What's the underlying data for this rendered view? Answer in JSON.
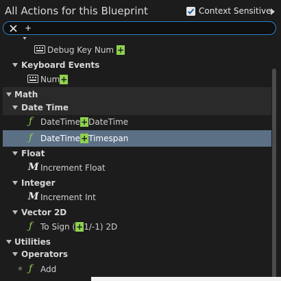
{
  "header": {
    "title": "All Actions for this Blueprint",
    "context_sensitive_label": "Context Sensitive",
    "context_sensitive_checked": true
  },
  "search": {
    "value": "+"
  },
  "rows": [
    {
      "type": "item",
      "icon": "keyboard-icon",
      "before": "Debug Key Num",
      "match": "+",
      "after": ""
    },
    {
      "type": "category",
      "label": "Keyboard Events"
    },
    {
      "type": "item",
      "icon": "keyboard-icon",
      "before": "Num",
      "match": "+",
      "after": ""
    },
    {
      "type": "category-major",
      "label": "Math"
    },
    {
      "type": "category",
      "label": "Date Time"
    },
    {
      "type": "item",
      "icon": "function-icon",
      "before": "DateTime",
      "match": "+",
      "after": "DateTime"
    },
    {
      "type": "item",
      "icon": "function-icon",
      "before": "DateTime",
      "match": "+",
      "after": "Timespan",
      "selected": true
    },
    {
      "type": "category",
      "label": "Float"
    },
    {
      "type": "item",
      "icon": "macro-icon",
      "before": "Increment Float",
      "match": "",
      "after": ""
    },
    {
      "type": "category",
      "label": "Integer"
    },
    {
      "type": "item",
      "icon": "macro-icon",
      "before": "Increment Int",
      "match": "",
      "after": ""
    },
    {
      "type": "category",
      "label": "Vector 2D"
    },
    {
      "type": "item",
      "icon": "function-icon",
      "before": "To Sign (",
      "match": "+",
      "after": "1/-1) 2D"
    },
    {
      "type": "category",
      "label": "Utilities"
    },
    {
      "type": "category",
      "label": "Operators"
    },
    {
      "type": "item",
      "icon": "function-icon",
      "before": "Add",
      "match": "",
      "after": "",
      "favorite": true
    }
  ],
  "colors": {
    "accent": "#2f80c8",
    "match_highlight": "#8fd14f",
    "selected_row": "#5b6f85"
  }
}
